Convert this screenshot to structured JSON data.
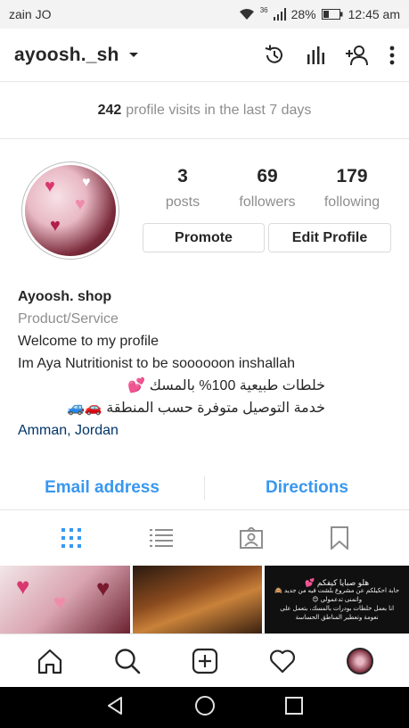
{
  "status_bar": {
    "carrier": "zain JO",
    "battery": "28%",
    "time": "12:45 am",
    "network": "36"
  },
  "header": {
    "username": "ayoosh._sh"
  },
  "visits": {
    "count": "242",
    "text": "profile visits in the last 7 days"
  },
  "stats": [
    {
      "value": "3",
      "label": "posts"
    },
    {
      "value": "69",
      "label": "followers"
    },
    {
      "value": "179",
      "label": "following"
    }
  ],
  "buttons": {
    "promote": "Promote",
    "edit_profile": "Edit Profile"
  },
  "bio": {
    "name": "Ayoosh. shop",
    "category": "Product/Service",
    "line1": "Welcome to my profile",
    "line2": "Im Aya Nutritionist to be soooooon inshallah",
    "line3": "خلطات طبيعية 100% بالمسك 💕",
    "line4": "خدمة التوصيل متوفرة حسب المنطقة 🚗🚙",
    "location": "Amman, Jordan"
  },
  "contact": {
    "email": "Email address",
    "directions": "Directions"
  },
  "post3": {
    "title": "هلو صبايا كيفكم 💕",
    "line1": "حابة احكيلكم عن مشروع بلشت فيه من جديد 🙈",
    "line2": "واتمنى تدعمولي 😊",
    "line3": "انا بعمل خلطات بودرات بالمسك، بتعمل على",
    "line4": "نعومة وتعطير المناطق الحساسة"
  },
  "colors": {
    "accent": "#3897f0",
    "text": "#262626",
    "muted": "#8e8e8e",
    "link": "#003569",
    "border": "#dbdbdb"
  }
}
